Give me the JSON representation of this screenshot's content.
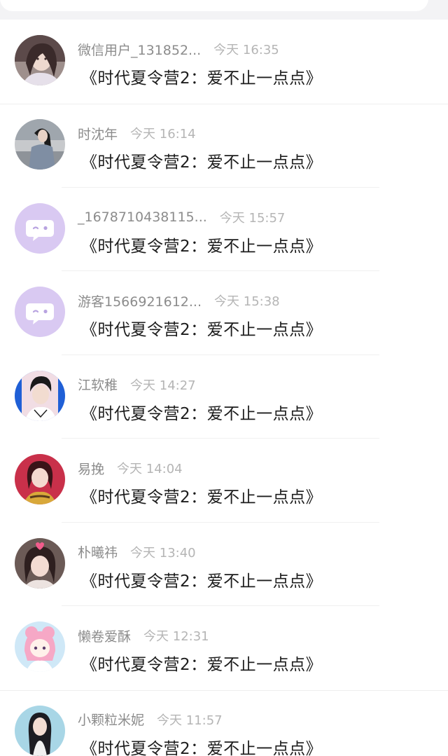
{
  "comments": [
    {
      "name": "微信用户_131852...",
      "time": "今天 16:35",
      "text": "《时代夏令营2：爱不止一点点》",
      "avatar": "photo-girl-portrait"
    },
    {
      "name": "时沈年",
      "time": "今天 16:14",
      "text": "《时代夏令营2：爱不止一点点》",
      "avatar": "photo-girl-street"
    },
    {
      "name": "_1678710438115...",
      "time": "今天 15:57",
      "text": "《时代夏令营2：爱不止一点点》",
      "avatar": "default-chat-bubble-icon"
    },
    {
      "name": "游客1566921612...",
      "time": "今天 15:38",
      "text": "《时代夏令营2：爱不止一点点》",
      "avatar": "default-chat-bubble-icon"
    },
    {
      "name": "江软稚",
      "time": "今天 14:27",
      "text": "《时代夏令营2：爱不止一点点》",
      "avatar": "photo-boy-blue-background"
    },
    {
      "name": "易挽",
      "time": "今天 14:04",
      "text": "《时代夏令营2：爱不止一点点》",
      "avatar": "photo-girl-red-background"
    },
    {
      "name": "朴曦祎",
      "time": "今天 13:40",
      "text": "《时代夏令营2：爱不止一点点》",
      "avatar": "photo-girl-heart-filter"
    },
    {
      "name": "懒卷爱酥",
      "time": "今天 12:31",
      "text": "《时代夏令营2：爱不止一点点》",
      "avatar": "anime-girl-pink-hair"
    },
    {
      "name": "小颗粒米妮",
      "time": "今天 11:57",
      "text": "《时代夏令营2：爱不止一点点》",
      "avatar": "photo-girl-long-hair"
    }
  ],
  "colors": {
    "background": "#f3f3f5",
    "name_text": "#8c8c8c",
    "time_text": "#b5b5b5",
    "message_text": "#1d1d1d",
    "default_avatar": "#d9c9f2"
  }
}
